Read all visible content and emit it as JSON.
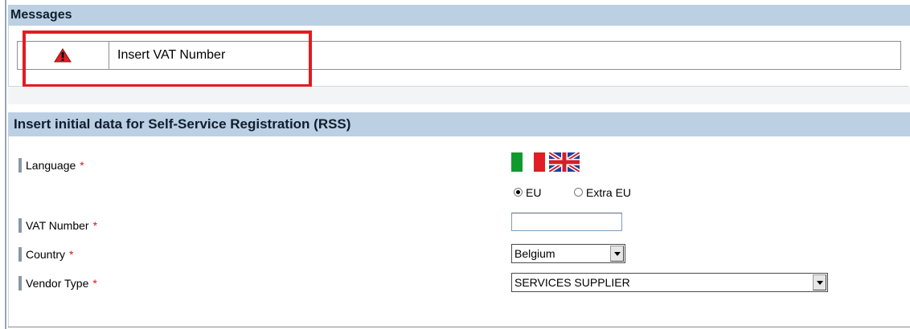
{
  "messages": {
    "title": "Messages",
    "items": [
      {
        "icon": "warning-icon",
        "text": "Insert VAT Number"
      }
    ]
  },
  "form": {
    "title": "Insert initial data for Self-Service Registration (RSS)",
    "required_marker": "*",
    "language": {
      "label": "Language",
      "flags": [
        "italy-flag-icon",
        "uk-flag-icon"
      ],
      "options": [
        "EU",
        "Extra EU"
      ],
      "selected": "EU"
    },
    "vat": {
      "label": "VAT Number",
      "value": ""
    },
    "country": {
      "label": "Country",
      "value": "Belgium"
    },
    "vendor_type": {
      "label": "Vendor Type",
      "value": "SERVICES SUPPLIER"
    }
  },
  "colors": {
    "section_header_bg": "#bcd0e3",
    "highlight_border": "#e21b22",
    "required": "#d11a1a"
  }
}
